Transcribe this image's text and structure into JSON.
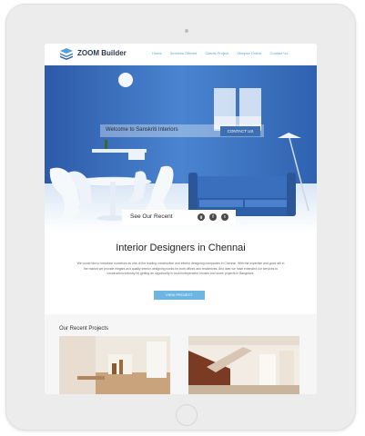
{
  "header": {
    "brand": "ZOOM Builder",
    "nav": [
      "Home",
      "Services Offered",
      "Clients Project",
      "Glimpse Online",
      "Contact Us"
    ]
  },
  "hero": {
    "welcome": "Welcome to Sanskriti Interiors",
    "contact_label": "CONTACT US",
    "recent_label": "See Our Recent",
    "social": [
      "g",
      "f",
      "t"
    ]
  },
  "intro": {
    "title_strong": "Interior Designers",
    "title_rest": " in Chennai",
    "description": "We would like to introduce ourselves as one of the leading construction and interior designing companies in Chennai. With the expertise and good will in the market we provide elegant and quality interior designing works for both offices and residences. And later we have extended our services to construction industry by getting an opportunity to build independent houses and some projects in Bangalore.",
    "button_label": "VIEW PROJECT"
  },
  "projects": {
    "heading": "Our Recent Projects"
  },
  "colors": {
    "accent": "#58a4d4",
    "hero_wall": "#3568b8",
    "button_blue": "#6db6e3"
  }
}
